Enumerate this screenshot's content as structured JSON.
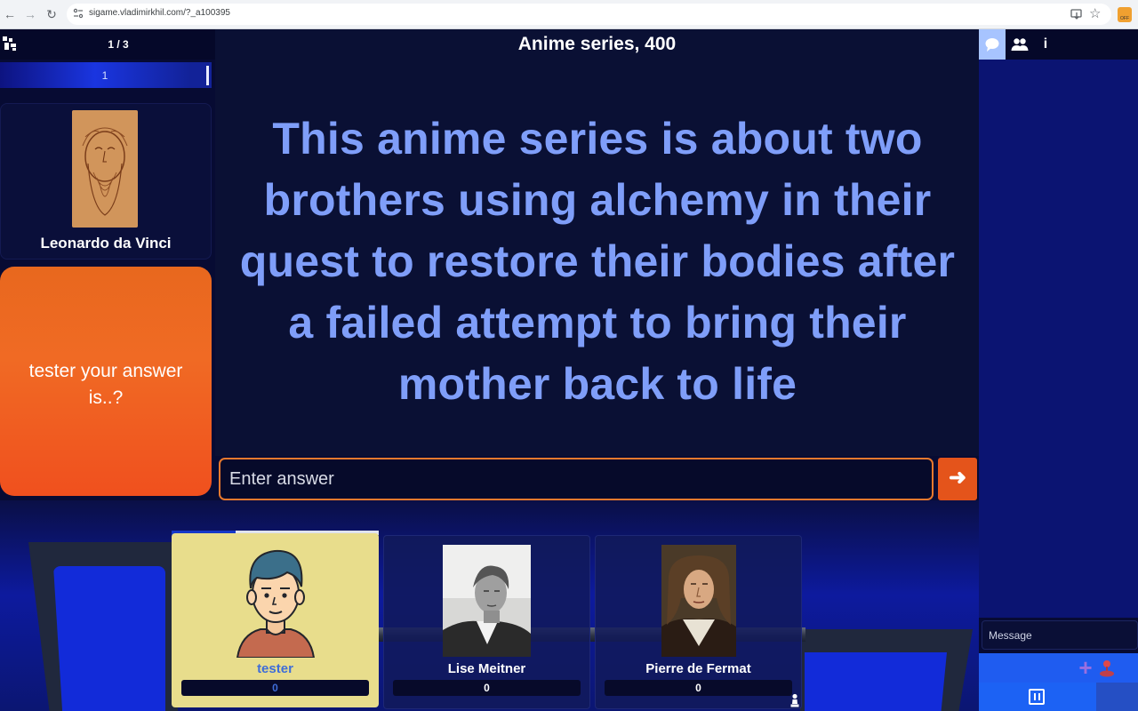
{
  "browser": {
    "url": "sigame.vladimirkhil.com/?_a100395",
    "extension_badge": "OFF"
  },
  "header": {
    "round_counter": "1 / 3",
    "theme_title": "Anime series, 400"
  },
  "progress": {
    "value": "1"
  },
  "host": {
    "name": "Leonardo da Vinci"
  },
  "answer_prompt": {
    "text": "tester your answer is..?"
  },
  "question": {
    "text": "This anime series is about two brothers using alchemy in their quest to restore their bodies after a failed attempt to bring their mother back to life"
  },
  "answer_input": {
    "placeholder": "Enter answer"
  },
  "timer": {
    "remaining_fraction": 0.31
  },
  "players": [
    {
      "name": "tester",
      "score": "0",
      "active": true
    },
    {
      "name": "Lise Meitner",
      "score": "0",
      "active": false
    },
    {
      "name": "Pierre de Fermat",
      "score": "0",
      "active": false
    }
  ],
  "chat": {
    "message_placeholder": "Message"
  },
  "icons": {
    "logo": "sigame-logo-icon",
    "send": "arrow-right-icon",
    "chat": "chat-bubble-icon",
    "people": "people-icon",
    "info": "info-icon",
    "add": "plus-icon",
    "game": "joystick-icon",
    "pause": "pause-icon",
    "pawn": "pawn-icon"
  },
  "colors": {
    "background": "#070b33",
    "question_text": "#7f9ef9",
    "answer_prompt": "#f06a24",
    "active_player": "#e8dd8c",
    "accent": "#1f5cf0",
    "send_button": "#e4541b"
  }
}
